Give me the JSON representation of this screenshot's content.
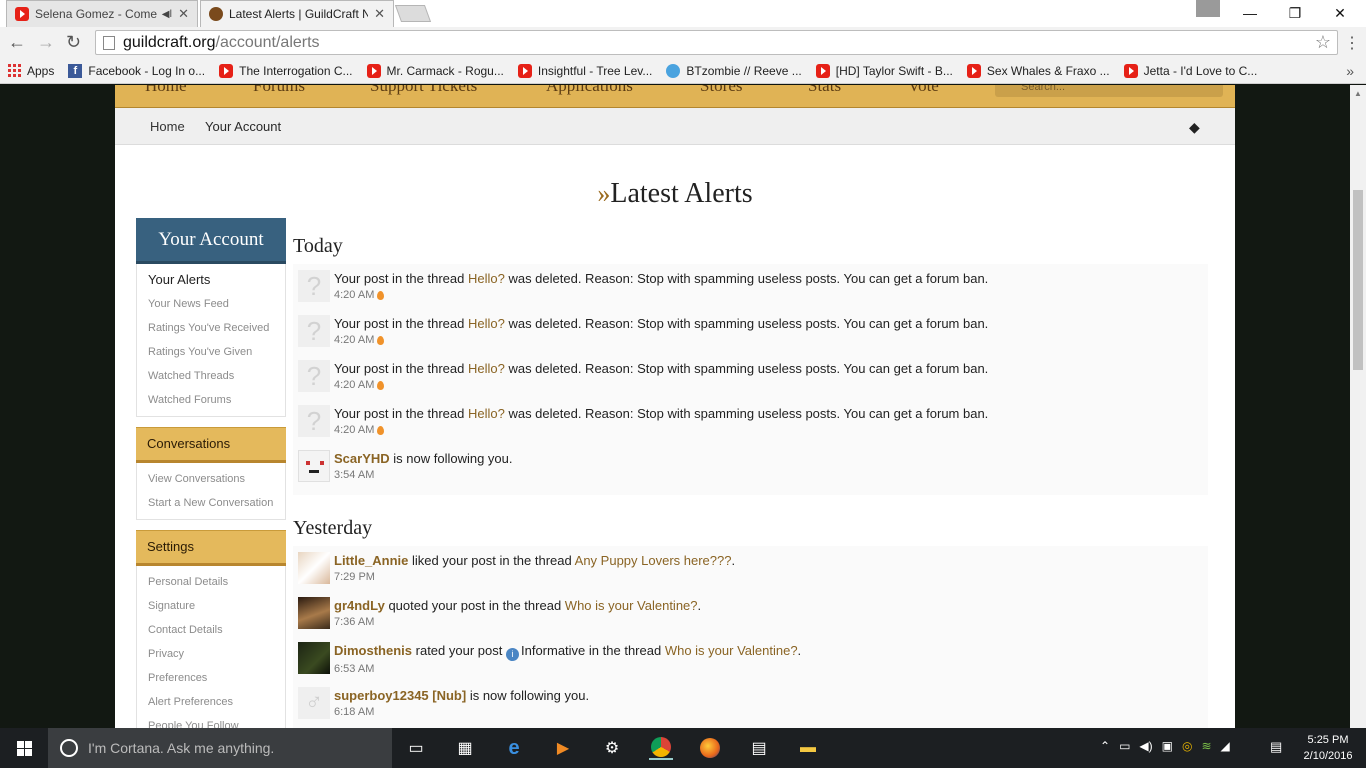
{
  "browser": {
    "tabs": [
      {
        "title": "Selena Gomez - Come ·",
        "icon": "youtube-icon",
        "muted_icon": "speaker-icon"
      },
      {
        "title": "Latest Alerts | GuildCraft N",
        "icon": "guildcraft-icon"
      }
    ],
    "url_host": "guildcraft.org",
    "url_path": "/account/alerts",
    "bookmarks": [
      {
        "label": "Apps",
        "icon": "apps-grid-icon"
      },
      {
        "label": "Facebook - Log In o...",
        "icon": "facebook-icon"
      },
      {
        "label": "The Interrogation C...",
        "icon": "youtube-icon"
      },
      {
        "label": "Mr. Carmack - Rogu...",
        "icon": "youtube-icon"
      },
      {
        "label": "Insightful - Tree Lev...",
        "icon": "youtube-icon"
      },
      {
        "label": "BTzombie // Reeve ...",
        "icon": "twitter-icon"
      },
      {
        "label": "[HD] Taylor Swift - B...",
        "icon": "youtube-icon"
      },
      {
        "label": "Sex Whales & Fraxo ...",
        "icon": "youtube-icon"
      },
      {
        "label": "Jetta - I'd Love to C...",
        "icon": "youtube-icon"
      }
    ]
  },
  "site": {
    "nav": [
      "Home",
      "Forums",
      "Support Tickets",
      "Applications",
      "Stores",
      "Stats",
      "Vote"
    ],
    "search_placeholder": "Search...",
    "breadcrumb": {
      "home": "Home",
      "current": "Your Account"
    },
    "page_title_prefix": "»",
    "page_title": "Latest Alerts"
  },
  "sidebar": {
    "account_header": "Your Account",
    "account_items": [
      {
        "label": "Your Alerts",
        "selected": true
      },
      {
        "label": "Your News Feed"
      },
      {
        "label": "Ratings You've Received"
      },
      {
        "label": "Ratings You've Given"
      },
      {
        "label": "Watched Threads"
      },
      {
        "label": "Watched Forums"
      }
    ],
    "conversations_header": "Conversations",
    "conversation_items": [
      "View Conversations",
      "Start a New Conversation"
    ],
    "settings_header": "Settings",
    "settings_items": [
      "Personal Details",
      "Signature",
      "Contact Details",
      "Privacy",
      "Preferences",
      "Alert Preferences",
      "People You Follow"
    ]
  },
  "alerts": {
    "today_label": "Today",
    "yesterday_label": "Yesterday",
    "deleted_text_a": "Your post in the thread",
    "deleted_thread": "Hello?",
    "deleted_text_b": "was deleted. Reason: Stop with spamming useless posts. You can get a forum ban.",
    "deleted_time": "4:20 AM",
    "follow_user_1": "ScarYHD",
    "follow_text": "is now following you.",
    "follow_time_1": "3:54 AM",
    "y1_user": "Little_Annie",
    "y1_text": "liked your post in the thread",
    "y1_thread": "Any Puppy Lovers here???",
    "y1_end": ".",
    "y1_time": "7:29 PM",
    "y2_user": "gr4ndLy",
    "y2_text": "quoted your post in the thread",
    "y2_thread": "Who is your Valentine?",
    "y2_end": ".",
    "y2_time": "7:36 AM",
    "y3_user": "Dimosthenis",
    "y3_text_a": "rated your post",
    "y3_rating": "Informative",
    "y3_text_b": "in the thread",
    "y3_thread": "Who is your Valentine?",
    "y3_end": ".",
    "y3_time": "6:53 AM",
    "y4_user": "superboy12345 [Nub]",
    "y4_text": "is now following you.",
    "y4_time": "6:18 AM"
  },
  "taskbar": {
    "cortana_placeholder": "I'm Cortana. Ask me anything.",
    "time": "5:25 PM",
    "date": "2/10/2016"
  }
}
